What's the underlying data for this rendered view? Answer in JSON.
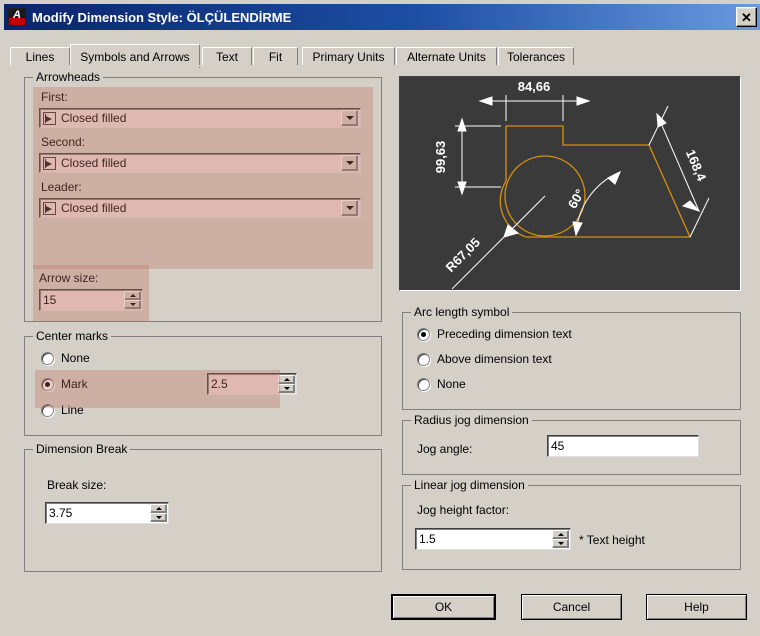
{
  "window": {
    "title": "Modify Dimension Style: ÖLÇÜLENDİRME",
    "icon": "autocad-logo-icon",
    "close_label": "✕"
  },
  "tabs": [
    {
      "label": "Lines",
      "active": false
    },
    {
      "label": "Symbols and Arrows",
      "active": true
    },
    {
      "label": "Text",
      "active": false
    },
    {
      "label": "Fit",
      "active": false
    },
    {
      "label": "Primary Units",
      "active": false
    },
    {
      "label": "Alternate Units",
      "active": false
    },
    {
      "label": "Tolerances",
      "active": false
    }
  ],
  "arrowheads": {
    "group_label": "Arrowheads",
    "first": {
      "label": "First:",
      "value": "Closed filled",
      "icon": "arrowhead-closed-filled-icon"
    },
    "second": {
      "label": "Second:",
      "value": "Closed filled",
      "icon": "arrowhead-closed-filled-icon"
    },
    "leader": {
      "label": "Leader:",
      "value": "Closed filled",
      "icon": "arrowhead-closed-filled-icon"
    },
    "arrow_size": {
      "label": "Arrow size:",
      "value": "15"
    }
  },
  "center_marks": {
    "group_label": "Center marks",
    "options": [
      {
        "label": "None",
        "selected": false
      },
      {
        "label": "Mark",
        "selected": true
      },
      {
        "label": "Line",
        "selected": false
      }
    ],
    "size_value": "2.5"
  },
  "dimension_break": {
    "group_label": "Dimension Break",
    "break_size_label": "Break size:",
    "break_size_value": "3.75"
  },
  "arc_length_symbol": {
    "group_label": "Arc length symbol",
    "options": [
      {
        "label": "Preceding dimension text",
        "selected": true
      },
      {
        "label": "Above dimension text",
        "selected": false
      },
      {
        "label": "None",
        "selected": false
      }
    ]
  },
  "radius_jog": {
    "group_label": "Radius jog dimension",
    "jog_angle_label": "Jog angle:",
    "jog_angle_value": "45"
  },
  "linear_jog": {
    "group_label": "Linear jog dimension",
    "jog_height_label": "Jog height factor:",
    "jog_height_value": "1.5",
    "suffix": "* Text height"
  },
  "preview": {
    "name": "dimension-style-preview",
    "background_color": "#3a3a3a",
    "geometry_color": "#d4900f",
    "dimension_color": "#ffffff",
    "dimensions": {
      "top_linear": "84,66",
      "left_vertical": "99,63",
      "angular": "60°",
      "aligned": "168,4",
      "radial": "R67,05"
    }
  },
  "footer": {
    "ok_label": "OK",
    "cancel_label": "Cancel",
    "help_label": "Help"
  }
}
